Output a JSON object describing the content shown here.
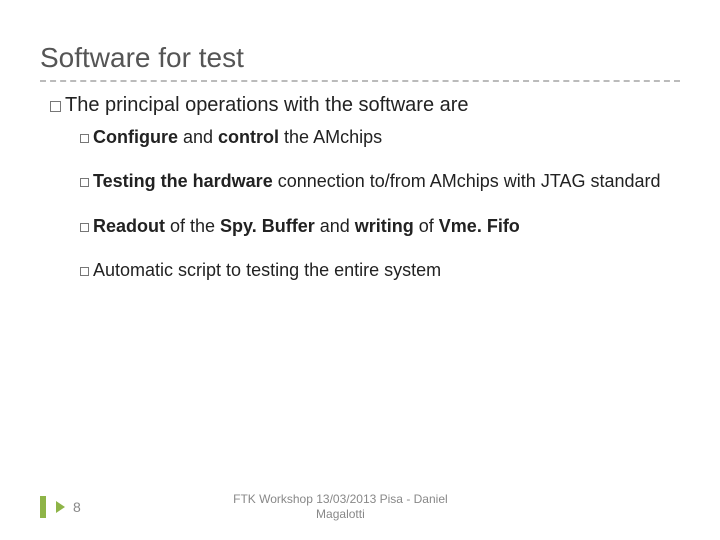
{
  "title": "Software for test",
  "main_bullet": {
    "prefix": "The",
    "rest": " principal operations with the software are"
  },
  "sub_bullets": [
    {
      "parts": [
        {
          "t": "Configure",
          "b": true
        },
        {
          "t": " and ",
          "b": false
        },
        {
          "t": "control",
          "b": true
        },
        {
          "t": " the AMchips",
          "b": false
        }
      ]
    },
    {
      "parts": [
        {
          "t": "Testing the hardware",
          "b": true
        },
        {
          "t": " connection to/from AMchips with JTAG standard",
          "b": false
        }
      ]
    },
    {
      "parts": [
        {
          "t": "Readout",
          "b": true
        },
        {
          "t": " of the ",
          "b": false
        },
        {
          "t": "Spy. Buffer",
          "b": true
        },
        {
          "t": " and ",
          "b": false
        },
        {
          "t": "writing",
          "b": true
        },
        {
          "t": " of ",
          "b": false
        },
        {
          "t": "Vme. Fifo",
          "b": true
        }
      ]
    },
    {
      "parts": [
        {
          "t": "Automatic",
          "b": false
        },
        {
          "t": " script to testing the entire system",
          "b": false
        }
      ]
    }
  ],
  "footer": {
    "page": "8",
    "text_line1": "FTK Workshop 13/03/2013 Pisa - Daniel",
    "text_line2": "Magalotti"
  }
}
